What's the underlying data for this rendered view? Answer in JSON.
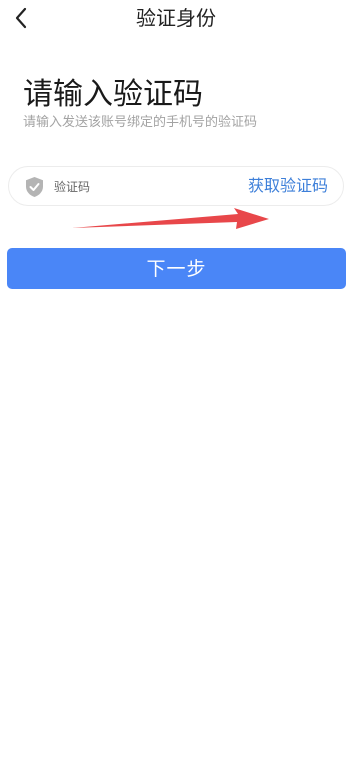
{
  "header": {
    "title": "验证身份",
    "back_icon": "chevron-left-icon"
  },
  "main": {
    "heading": "请输入验证码",
    "subheading": "请输入发送该账号绑定的手机号的验证码",
    "code_field": {
      "icon": "shield-check-icon",
      "placeholder": "验证码",
      "value": "",
      "get_code_label": "获取验证码"
    },
    "annotation": {
      "icon": "red-arrow-icon",
      "color": "#e8474a"
    },
    "next_button": {
      "label": "下一步",
      "color": "#4a86f7"
    }
  },
  "colors": {
    "accent": "#3d7fd9",
    "primary_button": "#4a86f7",
    "annotation_arrow": "#e8474a"
  }
}
